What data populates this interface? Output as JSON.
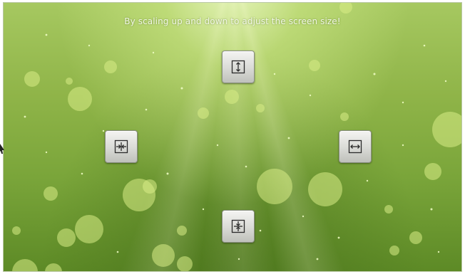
{
  "instruction_text": "By scaling up and down to adjust the screen size!",
  "buttons": {
    "scale_up_vertical": {
      "icon": "expand-vertical-icon"
    },
    "scale_down_horizontal": {
      "icon": "shrink-horizontal-icon"
    },
    "scale_up_horizontal": {
      "icon": "expand-horizontal-icon"
    },
    "scale_down_vertical": {
      "icon": "shrink-vertical-icon"
    }
  },
  "colors": {
    "background_light": "#a6c860",
    "background_dark": "#5d8a26",
    "button_face": "#d9dad6",
    "text": "#f3f8e6"
  }
}
